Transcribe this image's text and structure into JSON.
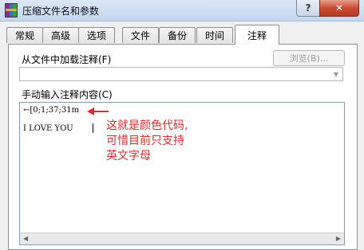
{
  "window": {
    "title": "压缩文件名和参数",
    "help_label": "?",
    "close_label": "✕"
  },
  "tabs": [
    {
      "label": "常规"
    },
    {
      "label": "高级"
    },
    {
      "label": "选项"
    },
    {
      "label": "文件"
    },
    {
      "label": "备份"
    },
    {
      "label": "时间"
    },
    {
      "label": "注释"
    }
  ],
  "active_tab": "注释",
  "load_section": {
    "label": "从文件中加载注释(F)",
    "browse_label": "浏览(B)...",
    "combo_value": ""
  },
  "manual_section": {
    "label": "手动输入注释内容(C)",
    "lines": [
      "←[0;1;37;31m",
      "I LOVE YOU"
    ]
  },
  "annotation": {
    "lines": [
      "这就是颜色代码,",
      "可惜目前只支持",
      "英文字母"
    ],
    "color": "#d92b2b"
  }
}
